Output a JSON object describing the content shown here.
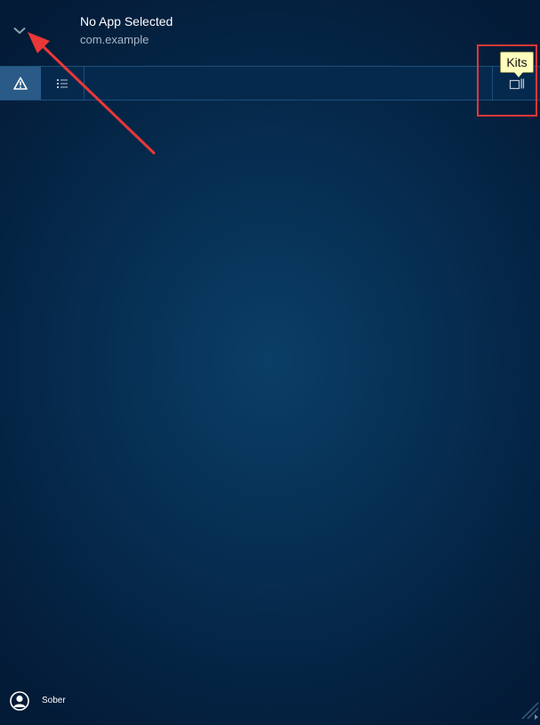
{
  "header": {
    "app_title": "No App Selected",
    "app_subtitle": "com.example",
    "toggle_icon": "chevron-down-icon"
  },
  "toolbar": {
    "tabs": [
      {
        "icon": "warning-icon",
        "selected": true
      },
      {
        "icon": "list-icon",
        "selected": false
      }
    ],
    "kits_icon": "kits-icon"
  },
  "tooltip": {
    "text": "Kits"
  },
  "footer": {
    "user_name": "Sober",
    "avatar_icon": "user-avatar-icon"
  },
  "annotation": {
    "color": "#e83838"
  }
}
